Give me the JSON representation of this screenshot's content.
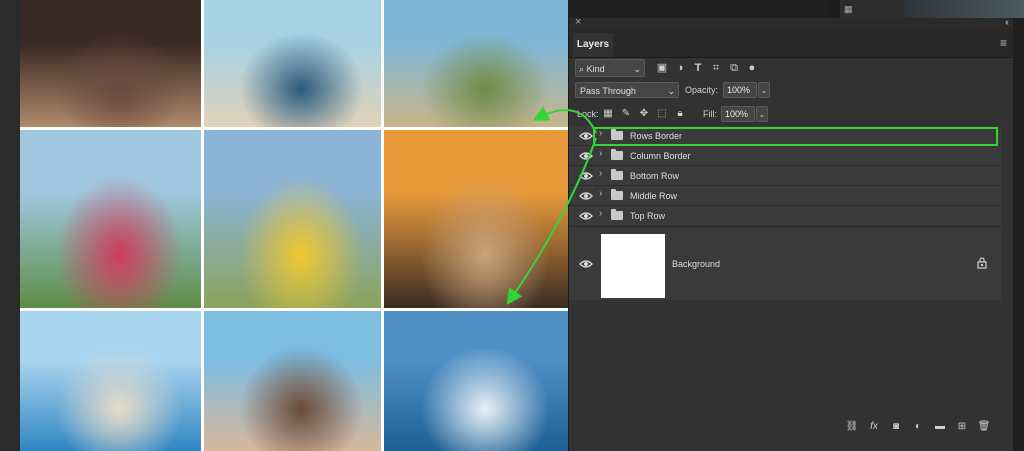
{
  "panel": {
    "close_glyph": "×",
    "collapse_glyph": "‹‹",
    "tab_label": "Layers",
    "menu_glyph": "≡"
  },
  "filter": {
    "kind_label": "Kind",
    "icons": [
      "image-filter-icon",
      "adjustment-filter-icon",
      "type-filter-icon",
      "shape-filter-icon",
      "smart-object-filter-icon",
      "filter-toggle-icon"
    ]
  },
  "blending": {
    "mode": "Pass Through",
    "opacity_label": "Opacity:",
    "opacity_value": "100%",
    "lock_label": "Lock:",
    "fill_label": "Fill:",
    "fill_value": "100%"
  },
  "layers": [
    {
      "name": "Rows Border",
      "type": "group",
      "visible": true,
      "highlighted": true
    },
    {
      "name": "Column Border",
      "type": "group",
      "visible": true
    },
    {
      "name": "Bottom Row",
      "type": "group",
      "visible": true
    },
    {
      "name": "Middle Row",
      "type": "group",
      "visible": true
    },
    {
      "name": "Top Row",
      "type": "group",
      "visible": true
    }
  ],
  "background_layer": {
    "name": "Background",
    "locked": true,
    "thumbnail_color": "#ffffff"
  },
  "bottom_toolbar": [
    "link-layers-icon",
    "fx-icon",
    "mask-icon",
    "adjustment-layer-icon",
    "new-group-icon",
    "new-layer-icon",
    "delete-icon"
  ],
  "colors": {
    "highlight": "#35d435",
    "panel_bg": "#323232",
    "row_bg": "#3a3a3a"
  },
  "photos": [
    {
      "name": "group-selfie",
      "colors": [
        "#3a2a24",
        "#b08a6a",
        "#6a4a40"
      ]
    },
    {
      "name": "books-sunglasses",
      "colors": [
        "#a7d2e4",
        "#e2d2b8",
        "#2b5a7d"
      ]
    },
    {
      "name": "hikers-cliff",
      "colors": [
        "#7fb8d6",
        "#c9b489",
        "#6f8b47"
      ]
    },
    {
      "name": "flowers-bay",
      "colors": [
        "#9fc8e0",
        "#5e8d46",
        "#cf3c5e"
      ]
    },
    {
      "name": "picnic-man",
      "colors": [
        "#8bb3d6",
        "#8ba35a",
        "#f0c830"
      ]
    },
    {
      "name": "sunset-blanket",
      "colors": [
        "#e89a3a",
        "#3a2c24",
        "#c9a27a"
      ]
    },
    {
      "name": "beach-reading",
      "colors": [
        "#a9d4ef",
        "#2f86c2",
        "#e9dcc8"
      ]
    },
    {
      "name": "couple-beach",
      "colors": [
        "#7cbde0",
        "#d9b79a",
        "#6b4a3a"
      ]
    },
    {
      "name": "boat-wake",
      "colors": [
        "#4f8fc4",
        "#1d5f94",
        "#e8f1f6"
      ]
    }
  ]
}
